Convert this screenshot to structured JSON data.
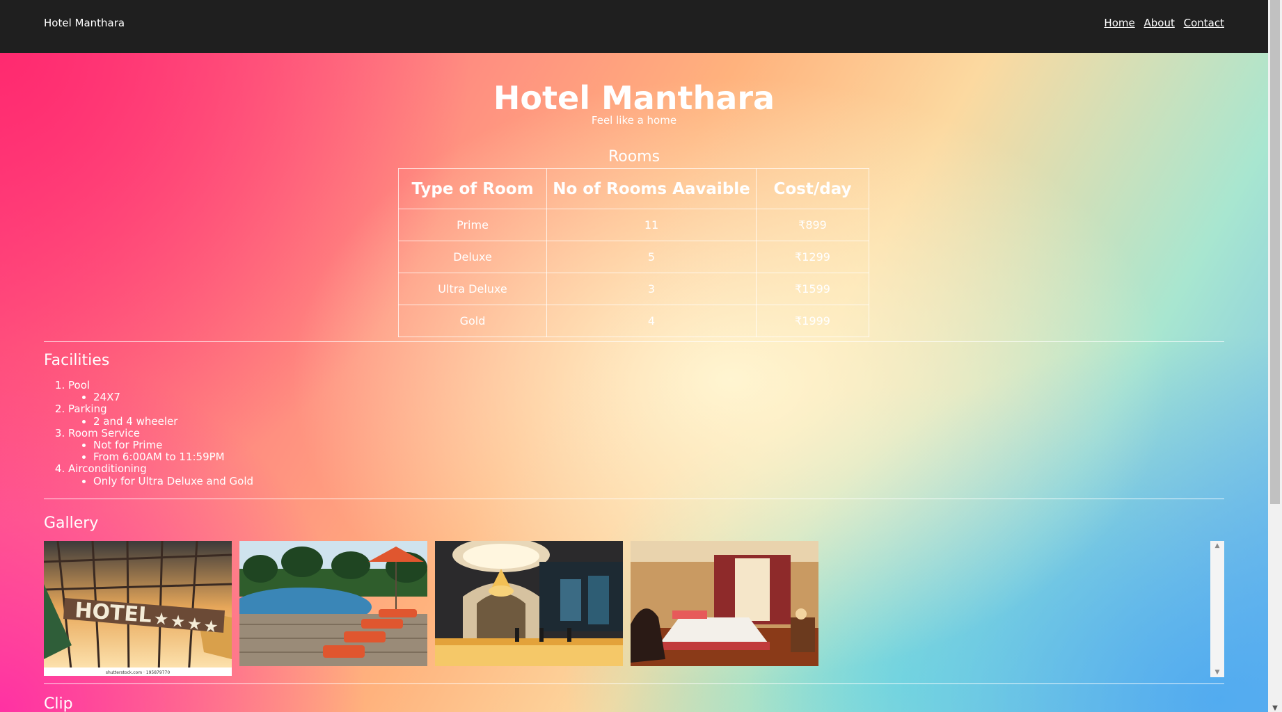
{
  "navbar": {
    "brand": "Hotel Manthara",
    "links": [
      "Home",
      "About",
      "Contact"
    ]
  },
  "hero": {
    "title": "Hotel Manthara",
    "subtitle": "Feel like a home"
  },
  "rooms": {
    "caption": "Rooms",
    "headers": [
      "Type of Room",
      "No of Rooms Aavaible",
      "Cost/day"
    ],
    "rows": [
      [
        "Prime",
        "11",
        "₹899"
      ],
      [
        "Deluxe",
        "5",
        "₹1299"
      ],
      [
        "Ultra Deluxe",
        "3",
        "₹1599"
      ],
      [
        "Gold",
        "4",
        "₹1999"
      ]
    ]
  },
  "facilities": {
    "heading": "Facilities",
    "items": [
      {
        "label": "Pool",
        "details": [
          "24X7"
        ]
      },
      {
        "label": "Parking",
        "details": [
          "2 and 4 wheeler"
        ]
      },
      {
        "label": "Room Service",
        "details": [
          "Not for Prime",
          "From 6:00AM to 11:59PM"
        ]
      },
      {
        "label": "Airconditioning",
        "details": [
          "Only for Ultra Deluxe and Gold"
        ]
      }
    ]
  },
  "gallery": {
    "heading": "Gallery",
    "images": [
      "hotel-sign-image",
      "pool-image",
      "lobby-image",
      "room-image"
    ],
    "hotel_sign_text": "HOTEL",
    "watermark": "shutterstock.com · 195879770"
  },
  "clip": {
    "heading": "Clip"
  }
}
